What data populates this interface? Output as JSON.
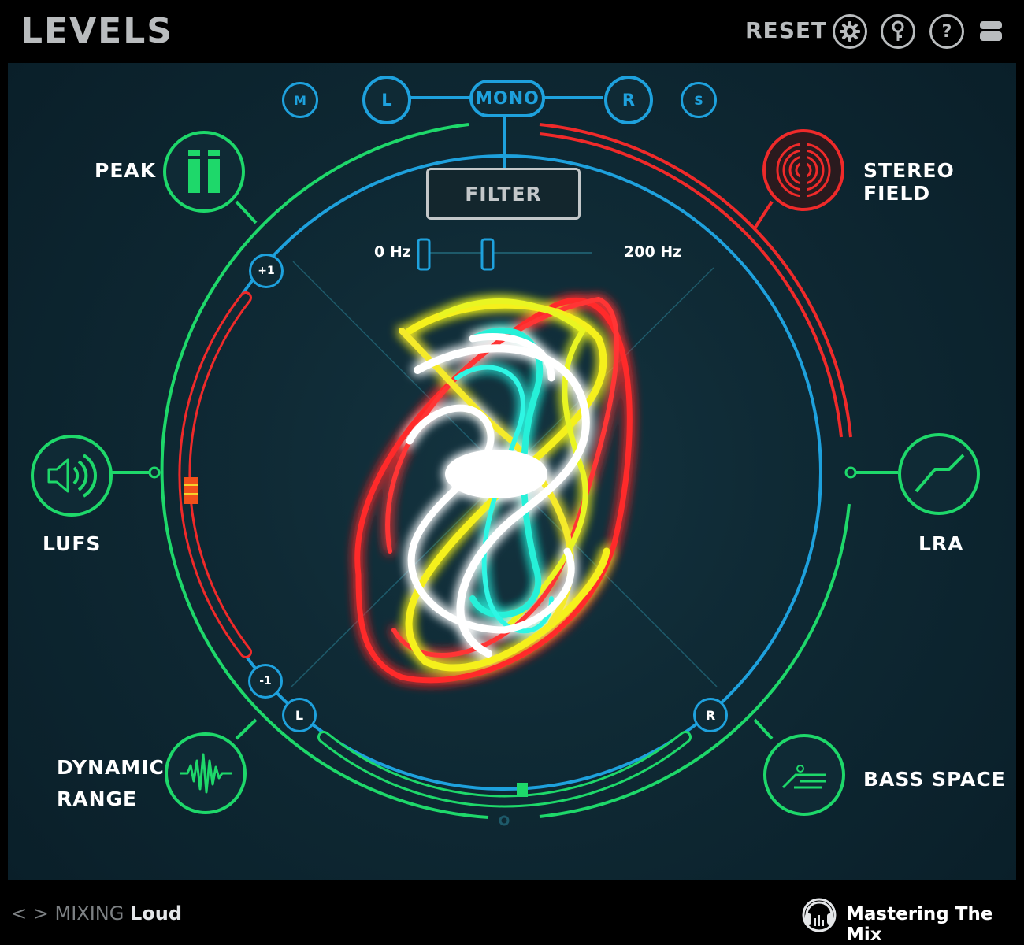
{
  "app": {
    "title": "LEVELS"
  },
  "toolbar": {
    "reset_label": "RESET",
    "settings_icon": "gear-icon",
    "key_icon": "key-icon",
    "help_label": "?",
    "window_icon": "window-toggle-icon"
  },
  "channel_modes": {
    "m": "M",
    "l": "L",
    "mono": "MONO",
    "r": "R",
    "s": "S"
  },
  "filter": {
    "label": "FILTER",
    "low": "0 Hz",
    "high": "200 Hz"
  },
  "meters": {
    "peak": "PEAK",
    "stereo_field": "STEREO FIELD",
    "lufs": "LUFS",
    "lra": "LRA",
    "dynamic_range_line1": "DYNAMIC",
    "dynamic_range_line2": "RANGE",
    "bass_space": "BASS SPACE"
  },
  "correlation": {
    "plus": "+1",
    "minus": "-1"
  },
  "balance": {
    "left": "L",
    "right": "R"
  },
  "footer": {
    "nav": "< >",
    "mixing": "MIXING",
    "loud": "Loud",
    "brand": "Mastering The Mix"
  },
  "colors": {
    "green": "#1ed86a",
    "blue": "#1ea1dd",
    "red": "#ef2a2a",
    "panel": "#0f2a35"
  }
}
